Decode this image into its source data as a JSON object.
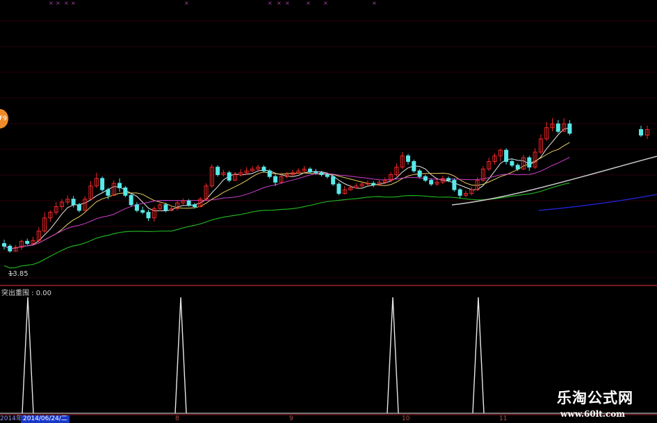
{
  "indicator": {
    "label": "突出重围 : 0.00"
  },
  "low_marker": {
    "label": "13.85"
  },
  "badge": {
    "text": "F9"
  },
  "date_bar": {
    "left_text": "2014年",
    "selected_date": "2014/06/24/二"
  },
  "month_ticks": [
    "8",
    "9",
    "10",
    "11"
  ],
  "watermark": {
    "line1": "乐淘公式网",
    "line2": "www.60lt.com"
  },
  "colors": {
    "up": "#f02828",
    "down": "#58e8e8",
    "ma5": "#e8e8e8",
    "ma10": "#e8d060",
    "ma20": "#d040d0",
    "ma60": "#20b020",
    "ma120": "#c8c8c8",
    "ma250": "#2020c8",
    "divider": "#a02030",
    "signal": "#e8e8e8"
  },
  "chart_data": [
    {
      "type": "candlestick",
      "title": "",
      "low_annotation": 13.85,
      "price_range": [
        13.2,
        18.0
      ],
      "candles": [
        [
          14.02,
          13.95,
          14.12,
          13.86
        ],
        [
          13.95,
          13.82,
          14.0,
          13.78
        ],
        [
          13.82,
          13.92,
          13.98,
          13.8
        ],
        [
          13.92,
          14.08,
          14.12,
          13.85
        ],
        [
          14.08,
          14.02,
          14.15,
          13.98
        ],
        [
          14.02,
          14.1,
          14.2,
          14.0
        ],
        [
          14.1,
          14.35,
          14.45,
          14.05
        ],
        [
          14.35,
          14.7,
          14.85,
          14.3
        ],
        [
          14.7,
          14.85,
          14.9,
          14.6
        ],
        [
          14.85,
          15.0,
          15.12,
          14.78
        ],
        [
          15.0,
          15.12,
          15.2,
          14.9
        ],
        [
          15.12,
          15.2,
          15.3,
          15.05
        ],
        [
          15.2,
          15.05,
          15.28,
          14.98
        ],
        [
          15.05,
          14.9,
          15.1,
          14.85
        ],
        [
          14.9,
          15.2,
          15.28,
          14.88
        ],
        [
          15.2,
          15.55,
          15.68,
          15.18
        ],
        [
          15.55,
          15.75,
          15.9,
          15.5
        ],
        [
          15.75,
          15.45,
          15.8,
          15.4
        ],
        [
          15.45,
          15.3,
          15.5,
          15.2
        ],
        [
          15.3,
          15.62,
          15.7,
          15.28
        ],
        [
          15.62,
          15.5,
          15.75,
          15.4
        ],
        [
          15.5,
          15.3,
          15.55,
          15.25
        ],
        [
          15.3,
          15.05,
          15.35,
          15.0
        ],
        [
          15.05,
          14.9,
          15.12,
          14.85
        ],
        [
          14.9,
          14.85,
          15.0,
          14.8
        ],
        [
          14.85,
          14.7,
          14.92,
          14.62
        ],
        [
          14.7,
          14.95,
          15.0,
          14.6
        ],
        [
          14.95,
          15.05,
          15.1,
          14.88
        ],
        [
          15.05,
          14.9,
          15.1,
          14.85
        ],
        [
          14.9,
          14.95,
          15.02,
          14.88
        ],
        [
          14.95,
          15.1,
          15.15,
          14.9
        ],
        [
          15.1,
          15.15,
          15.22,
          15.05
        ],
        [
          15.15,
          15.05,
          15.2,
          15.0
        ],
        [
          15.05,
          15.0,
          15.1,
          14.95
        ],
        [
          15.0,
          15.2,
          15.25,
          14.98
        ],
        [
          15.2,
          15.55,
          15.62,
          15.15
        ],
        [
          15.55,
          16.05,
          16.12,
          15.5
        ],
        [
          16.05,
          15.85,
          16.1,
          15.8
        ],
        [
          15.85,
          15.9,
          15.98,
          15.8
        ],
        [
          15.9,
          15.7,
          15.95,
          15.65
        ],
        [
          15.7,
          15.85,
          15.92,
          15.68
        ],
        [
          15.85,
          15.9,
          16.0,
          15.8
        ],
        [
          15.9,
          15.95,
          16.05,
          15.85
        ],
        [
          15.95,
          16.0,
          16.08,
          15.92
        ],
        [
          16.0,
          16.05,
          16.12,
          15.95
        ],
        [
          16.05,
          15.95,
          16.1,
          15.9
        ],
        [
          15.95,
          15.8,
          16.0,
          15.75
        ],
        [
          15.8,
          15.65,
          15.85,
          15.55
        ],
        [
          15.65,
          15.8,
          15.9,
          15.6
        ],
        [
          15.8,
          15.85,
          15.92,
          15.75
        ],
        [
          15.85,
          15.9,
          15.98,
          15.82
        ],
        [
          15.9,
          15.95,
          16.02,
          15.88
        ],
        [
          15.95,
          16.0,
          16.08,
          15.9
        ],
        [
          16.0,
          15.92,
          16.05,
          15.88
        ],
        [
          15.92,
          15.9,
          16.0,
          15.85
        ],
        [
          15.9,
          15.85,
          15.95,
          15.8
        ],
        [
          15.85,
          15.8,
          15.9,
          15.75
        ],
        [
          15.8,
          15.6,
          15.85,
          15.55
        ],
        [
          15.6,
          15.35,
          15.65,
          15.3
        ],
        [
          15.35,
          15.45,
          15.55,
          15.32
        ],
        [
          15.45,
          15.5,
          15.58,
          15.42
        ],
        [
          15.5,
          15.55,
          15.62,
          15.48
        ],
        [
          15.55,
          15.6,
          15.68,
          15.52
        ],
        [
          15.6,
          15.62,
          15.7,
          15.55
        ],
        [
          15.62,
          15.58,
          15.68,
          15.52
        ],
        [
          15.58,
          15.65,
          15.72,
          15.55
        ],
        [
          15.65,
          15.7,
          15.78,
          15.6
        ],
        [
          15.7,
          15.85,
          15.92,
          15.65
        ],
        [
          15.85,
          16.05,
          16.15,
          15.8
        ],
        [
          16.05,
          16.35,
          16.45,
          16.0
        ],
        [
          16.35,
          16.2,
          16.4,
          16.12
        ],
        [
          16.2,
          15.95,
          16.25,
          15.9
        ],
        [
          15.95,
          15.8,
          16.0,
          15.75
        ],
        [
          15.8,
          15.7,
          15.85,
          15.65
        ],
        [
          15.7,
          15.6,
          15.75,
          15.55
        ],
        [
          15.6,
          15.65,
          15.72,
          15.55
        ],
        [
          15.65,
          15.75,
          15.82,
          15.6
        ],
        [
          15.75,
          15.7,
          15.8,
          15.65
        ],
        [
          15.7,
          15.45,
          15.75,
          15.4
        ],
        [
          15.45,
          15.3,
          15.5,
          15.22
        ],
        [
          15.3,
          15.35,
          15.42,
          15.25
        ],
        [
          15.35,
          15.45,
          15.52,
          15.3
        ],
        [
          15.45,
          15.7,
          15.78,
          15.42
        ],
        [
          15.7,
          16.0,
          16.08,
          15.65
        ],
        [
          16.0,
          16.2,
          16.3,
          15.95
        ],
        [
          16.2,
          16.35,
          16.42,
          16.12
        ],
        [
          16.35,
          16.5,
          16.55,
          16.2
        ],
        [
          16.5,
          16.2,
          16.55,
          16.12
        ],
        [
          16.2,
          16.1,
          16.28,
          16.05
        ],
        [
          16.1,
          16.0,
          16.15,
          15.95
        ],
        [
          16.0,
          16.3,
          16.38,
          15.98
        ],
        [
          16.3,
          16.05,
          16.35,
          15.95
        ],
        [
          16.05,
          16.45,
          16.55,
          16.0
        ],
        [
          16.45,
          16.8,
          16.92,
          16.4
        ],
        [
          16.8,
          17.1,
          17.25,
          16.75
        ],
        [
          17.1,
          17.2,
          17.35,
          17.0
        ],
        [
          17.2,
          17.0,
          17.3,
          16.95
        ],
        [
          17.0,
          17.2,
          17.35,
          16.98
        ],
        [
          17.2,
          16.95,
          17.3,
          16.9
        ]
      ],
      "note_tail_candles": [
        [
          17.05,
          16.9,
          17.15,
          16.85
        ],
        [
          16.9,
          17.05,
          17.15,
          16.8
        ]
      ],
      "moving_averages": [
        "MA5",
        "MA10",
        "MA20",
        "MA60",
        "MA120",
        "MA250"
      ]
    },
    {
      "type": "line",
      "title": "",
      "series": [
        {
          "name": "突出重围",
          "values_note": "signal spikes to 1 at these bar indices, otherwise 0",
          "spike_bars": [
            2,
            35,
            76,
            94
          ]
        }
      ],
      "ylim": [
        0,
        1
      ]
    }
  ]
}
